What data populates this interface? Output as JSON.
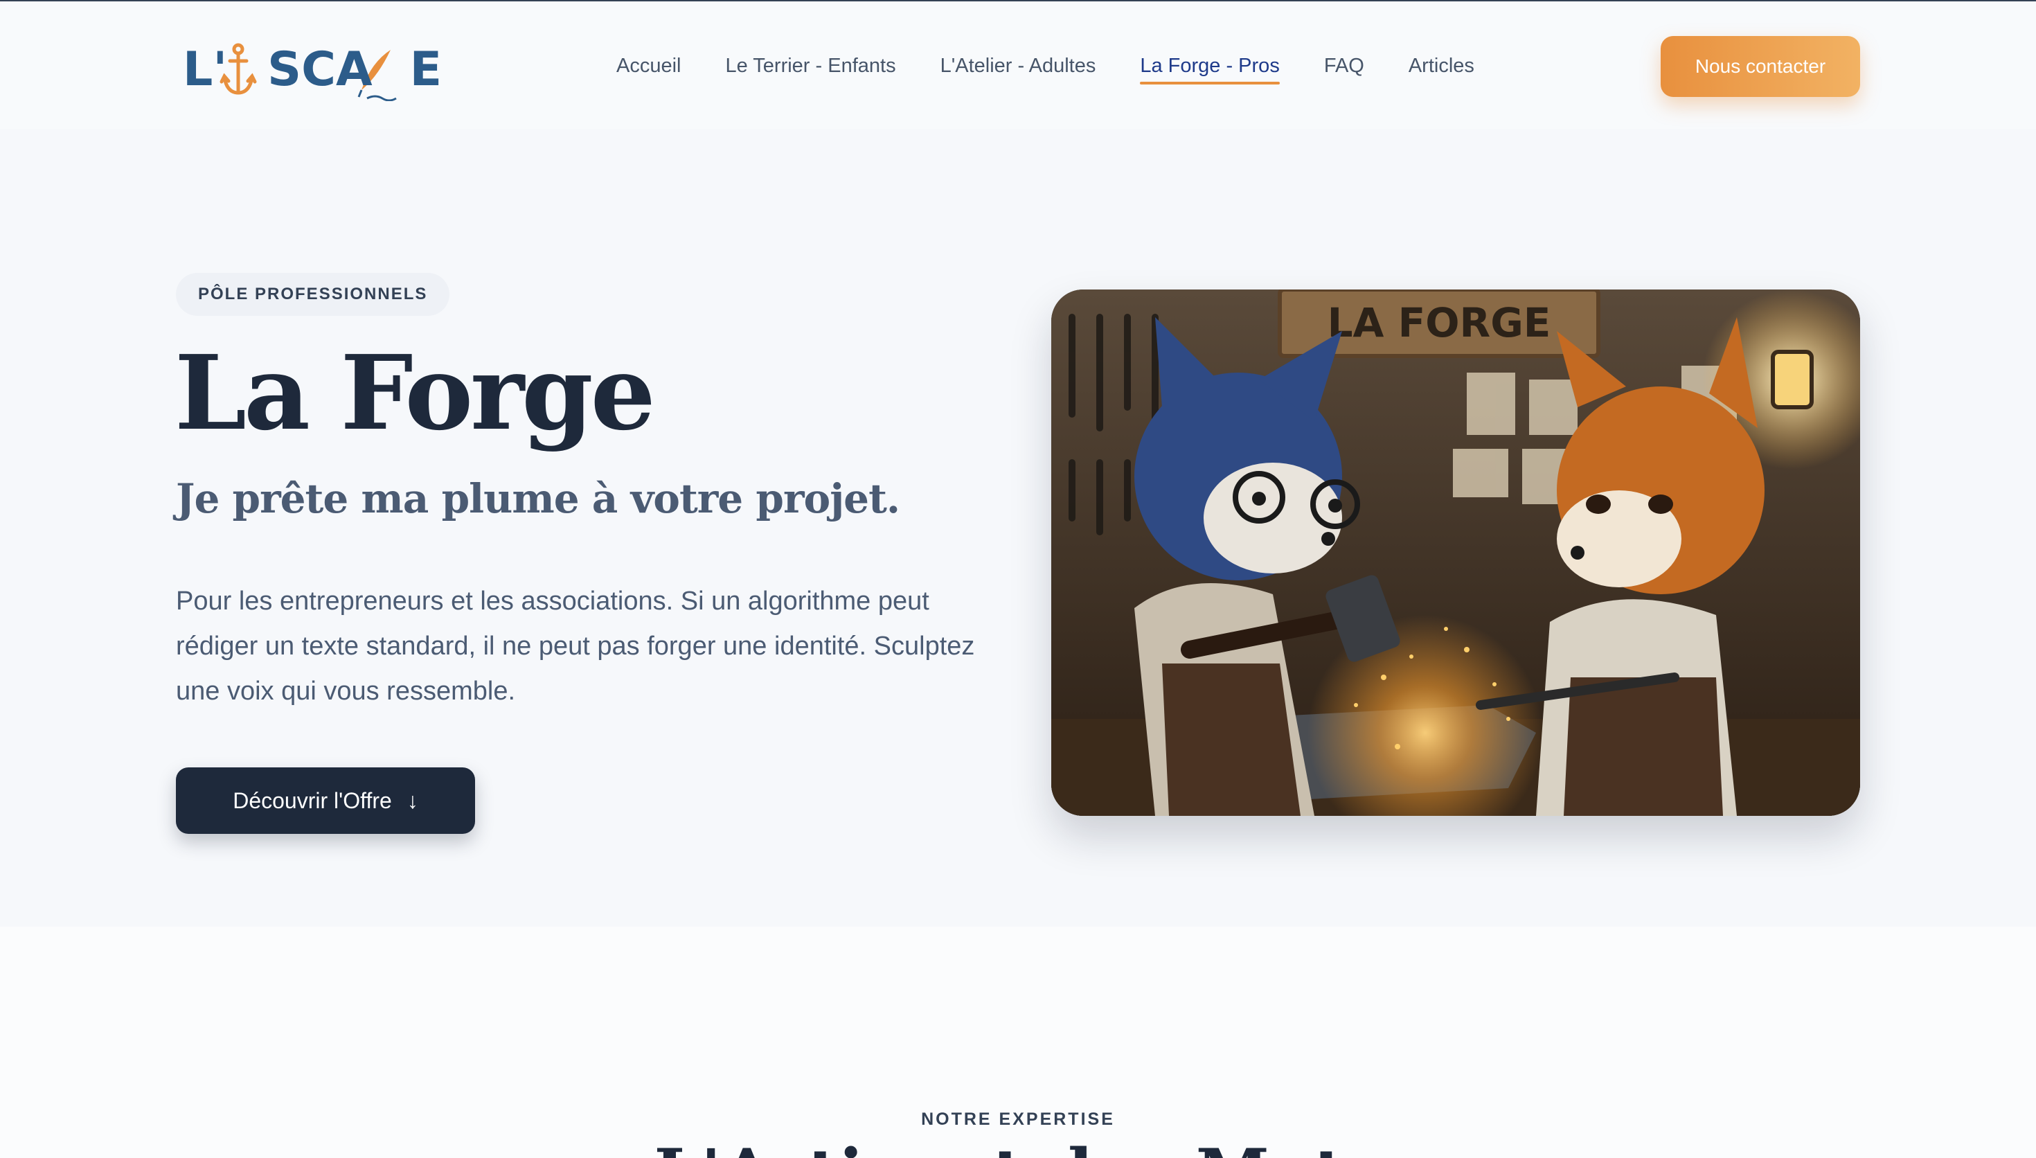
{
  "brand": {
    "logo_text": "L'ESCALE",
    "accent_color": "#e8903e",
    "primary_color": "#1e293b",
    "logo_color": "#2c5c8a"
  },
  "nav": {
    "links": [
      {
        "label": "Accueil",
        "active": false
      },
      {
        "label": "Le Terrier - Enfants",
        "active": false
      },
      {
        "label": "L'Atelier - Adultes",
        "active": false
      },
      {
        "label": "La Forge - Pros",
        "active": true
      },
      {
        "label": "FAQ",
        "active": false
      },
      {
        "label": "Articles",
        "active": false
      }
    ],
    "cta_label": "Nous contacter"
  },
  "hero": {
    "eyebrow": "PÔLE PROFESSIONNELS",
    "title": "La Forge",
    "subtitle": "Je prête ma plume à votre projet.",
    "description": "Pour les entrepreneurs et les associations. Si un algorithme peut rédiger un texte standard, il ne peut pas forger une identité. Sculptez une voix qui vous ressemble.",
    "button_label": "Découvrir l'Offre",
    "button_icon": "arrow-down-icon",
    "image": {
      "sign_text": "LA FORGE"
    }
  },
  "expertise": {
    "eyebrow": "NOTRE EXPERTISE",
    "title": "L'Artisant des Mots"
  }
}
